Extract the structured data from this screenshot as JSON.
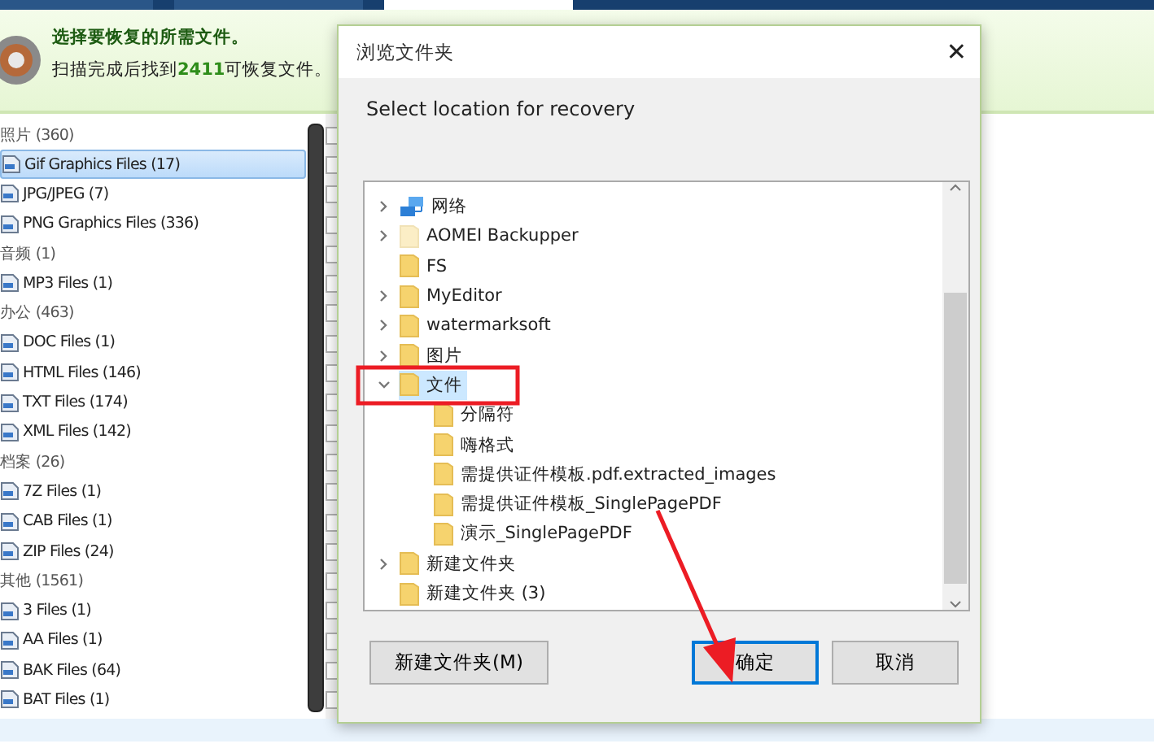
{
  "tabs": [
    {
      "selected": false
    },
    {
      "selected": false
    },
    {
      "selected": true
    }
  ],
  "header": {
    "title": "选择要恢复的所需文件。",
    "summary": "扫描完成后找到**2411**可恢复文件。"
  },
  "file_list": [
    {
      "kind": "category",
      "label": "照片 (360)",
      "selected": false,
      "checked": false
    },
    {
      "kind": "file",
      "label": "Gif Graphics Files (17)",
      "selected": true,
      "checked": false
    },
    {
      "kind": "file",
      "label": "JPG/JPEG (7)",
      "selected": false,
      "checked": false
    },
    {
      "kind": "file",
      "label": "PNG Graphics Files (336)",
      "selected": false,
      "checked": false
    },
    {
      "kind": "category",
      "label": "音频 (1)",
      "selected": false,
      "checked": false
    },
    {
      "kind": "file",
      "label": "MP3 Files (1)",
      "selected": false,
      "checked": false
    },
    {
      "kind": "category",
      "label": "办公 (463)",
      "selected": false,
      "checked": false
    },
    {
      "kind": "file",
      "label": "DOC Files (1)",
      "selected": false,
      "checked": false
    },
    {
      "kind": "file",
      "label": "HTML Files (146)",
      "selected": false,
      "checked": false
    },
    {
      "kind": "file",
      "label": "TXT Files (174)",
      "selected": false,
      "checked": false
    },
    {
      "kind": "file",
      "label": "XML Files (142)",
      "selected": false,
      "checked": false
    },
    {
      "kind": "category",
      "label": "档案 (26)",
      "selected": false,
      "checked": false
    },
    {
      "kind": "file",
      "label": "7Z Files (1)",
      "selected": false,
      "checked": false
    },
    {
      "kind": "file",
      "label": "CAB Files (1)",
      "selected": false,
      "checked": false
    },
    {
      "kind": "file",
      "label": "ZIP Files (24)",
      "selected": false,
      "checked": false
    },
    {
      "kind": "category",
      "label": "其他 (1561)",
      "selected": false,
      "checked": false
    },
    {
      "kind": "file",
      "label": "3 Files (1)",
      "selected": false,
      "checked": false
    },
    {
      "kind": "file",
      "label": "AA Files (1)",
      "selected": false,
      "checked": false
    },
    {
      "kind": "file",
      "label": "BAK Files (64)",
      "selected": false,
      "checked": false
    },
    {
      "kind": "file",
      "label": "BAT Files (1)",
      "selected": false,
      "checked": false
    }
  ],
  "dialog": {
    "title": "浏览文件夹",
    "close": "✕",
    "prompt": "Select location for recovery",
    "tree": [
      {
        "kind": "network",
        "label": "网络",
        "has_children": true,
        "expanded": false,
        "selected": false
      },
      {
        "kind": "faded-folder",
        "label": "AOMEI Backupper",
        "has_children": true,
        "expanded": false,
        "selected": false
      },
      {
        "kind": "folder",
        "label": "FS",
        "has_children": false,
        "selected": false
      },
      {
        "kind": "folder",
        "label": "MyEditor",
        "has_children": true,
        "expanded": false,
        "selected": false
      },
      {
        "kind": "folder",
        "label": "watermarksoft",
        "has_children": true,
        "expanded": false,
        "selected": false
      },
      {
        "kind": "folder",
        "label": "图片",
        "has_children": true,
        "expanded": false,
        "selected": false
      },
      {
        "kind": "folder",
        "label": "文件",
        "has_children": true,
        "expanded": true,
        "selected": true,
        "children": [
          {
            "kind": "folder",
            "label": "分隔符",
            "has_children": false,
            "selected": false
          },
          {
            "kind": "folder",
            "label": "嗨格式",
            "has_children": false,
            "selected": false
          },
          {
            "kind": "folder",
            "label": "需提供证件模板.pdf.extracted_images",
            "has_children": false,
            "selected": false
          },
          {
            "kind": "folder",
            "label": "需提供证件模板_SinglePagePDF",
            "has_children": false,
            "selected": false
          },
          {
            "kind": "folder",
            "label": "演示_SinglePagePDF",
            "has_children": false,
            "selected": false
          }
        ]
      },
      {
        "kind": "folder",
        "label": "新建文件夹",
        "has_children": true,
        "expanded": false,
        "selected": false
      },
      {
        "kind": "folder",
        "label": "新建文件夹 (3)",
        "has_children": false,
        "selected": false
      }
    ],
    "buttons": [
      {
        "label": "新建文件夹(M)",
        "focused": false
      },
      {
        "label": "确定",
        "focused": true
      },
      {
        "label": "取消",
        "focused": false
      }
    ]
  }
}
